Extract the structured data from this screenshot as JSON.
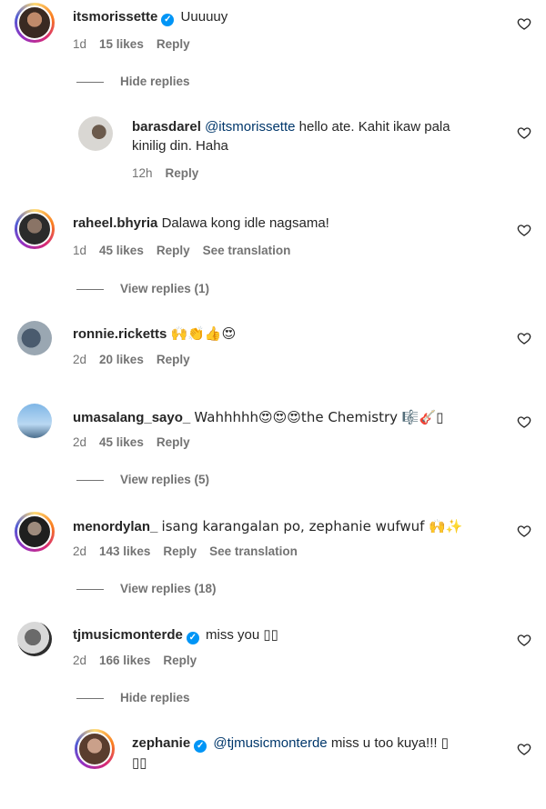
{
  "comments": [
    {
      "user": "itsmorissette",
      "verified": true,
      "text": "Uuuuuy",
      "time": "1d",
      "likes": "15 likes",
      "reply": "Reply",
      "toggle": "Hide replies"
    },
    {
      "user": "barasdarel",
      "mention": "@itsmorissette",
      "text": "hello ate. Kahit ikaw pala",
      "text2": "kinilig din. Haha",
      "time": "12h",
      "reply": "Reply"
    },
    {
      "user": "raheel.bhyria",
      "text": "Dalawa kong idle nagsama!",
      "time": "1d",
      "likes": "45 likes",
      "reply": "Reply",
      "translate": "See translation",
      "toggle": "View replies (1)"
    },
    {
      "user": "ronnie.ricketts",
      "text": "🙌👏👍😍",
      "time": "2d",
      "likes": "20 likes",
      "reply": "Reply"
    },
    {
      "user": "umasalang_sayo_",
      "text": "Wahhhhh😍😍😍the Chemistry 🎼🎸▯",
      "time": "2d",
      "likes": "45 likes",
      "reply": "Reply",
      "toggle": "View replies (5)"
    },
    {
      "user": "menordylan_",
      "text": "isang karangalan po, zephanie wufwuf 🙌✨",
      "time": "2d",
      "likes": "143 likes",
      "reply": "Reply",
      "translate": "See translation",
      "toggle": "View replies (18)"
    },
    {
      "user": "tjmusicmonterde",
      "verified": true,
      "text": "miss you ▯▯",
      "time": "2d",
      "likes": "166 likes",
      "reply": "Reply",
      "toggle": "Hide replies"
    },
    {
      "user": "zephanie",
      "verified": true,
      "mention": "@tjmusicmonterde",
      "text": "miss u too kuya!!! ▯",
      "text2": "▯▯"
    }
  ],
  "icons": {
    "heart": "heart-outline-icon",
    "verified": "verified-badge-icon"
  },
  "colors": {
    "text": "#262626",
    "meta": "#737373",
    "mention": "#00376b",
    "verified": "#0095f6"
  }
}
